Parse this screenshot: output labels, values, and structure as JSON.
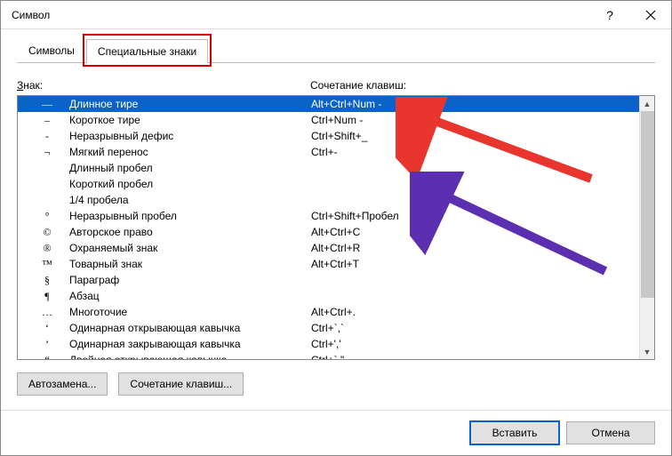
{
  "window": {
    "title": "Символ"
  },
  "tabs": {
    "symbols": "Символы",
    "special": "Специальные знаки"
  },
  "headers": {
    "char_prefix": "З",
    "char_rest": "нак:",
    "shortcut": "Сочетание клавиш:"
  },
  "rows": [
    {
      "sym": "—",
      "name": "Длинное тире",
      "shortcut": "Alt+Ctrl+Num -"
    },
    {
      "sym": "–",
      "name": "Короткое тире",
      "shortcut": "Ctrl+Num -"
    },
    {
      "sym": "-",
      "name": "Неразрывный дефис",
      "shortcut": "Ctrl+Shift+_"
    },
    {
      "sym": "¬",
      "name": "Мягкий перенос",
      "shortcut": "Ctrl+-"
    },
    {
      "sym": "",
      "name": "Длинный пробел",
      "shortcut": ""
    },
    {
      "sym": "",
      "name": "Короткий пробел",
      "shortcut": ""
    },
    {
      "sym": "",
      "name": "1/4 пробела",
      "shortcut": ""
    },
    {
      "sym": "°",
      "name": "Неразрывный пробел",
      "shortcut": "Ctrl+Shift+Пробел"
    },
    {
      "sym": "©",
      "name": "Авторское право",
      "shortcut": "Alt+Ctrl+C"
    },
    {
      "sym": "®",
      "name": "Охраняемый знак",
      "shortcut": "Alt+Ctrl+R"
    },
    {
      "sym": "™",
      "name": "Товарный знак",
      "shortcut": "Alt+Ctrl+T"
    },
    {
      "sym": "§",
      "name": "Параграф",
      "shortcut": ""
    },
    {
      "sym": "¶",
      "name": "Абзац",
      "shortcut": ""
    },
    {
      "sym": "…",
      "name": "Многоточие",
      "shortcut": "Alt+Ctrl+."
    },
    {
      "sym": "‘",
      "name": "Одинарная открывающая кавычка",
      "shortcut": "Ctrl+`,`"
    },
    {
      "sym": "’",
      "name": "Одинарная закрывающая кавычка",
      "shortcut": "Ctrl+','"
    },
    {
      "sym": "“",
      "name": "Двойная открывающая кавычка",
      "shortcut": "Ctrl+`,\""
    }
  ],
  "buttons": {
    "autocorrect": "Автозамена...",
    "shortcut": "Сочетание клавиш...",
    "insert": "Вставить",
    "cancel": "Отмена"
  }
}
